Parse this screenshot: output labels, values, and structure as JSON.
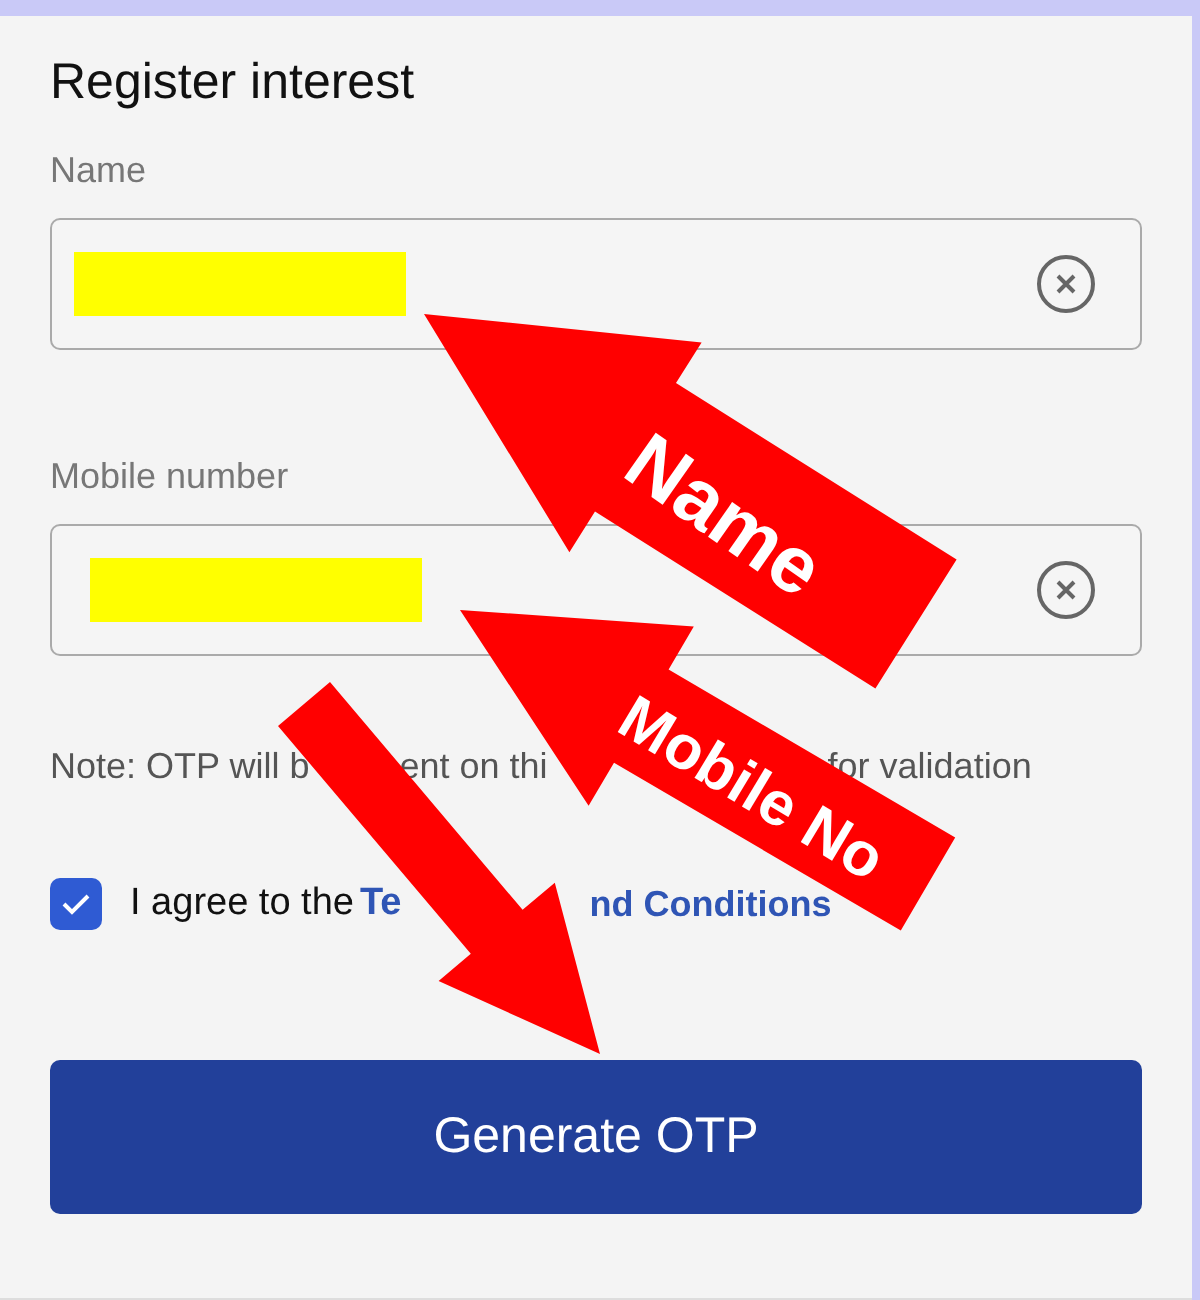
{
  "title": "Register interest",
  "fields": [
    {
      "label": "Name",
      "redacted": true
    },
    {
      "label": "Mobile number",
      "redacted": true
    }
  ],
  "note_fragments": [
    "Note: OTP will b",
    "ent on thi",
    "for validation"
  ],
  "agreement": {
    "checked": true,
    "text": "I agree to the",
    "link_fragments": [
      "Te",
      "nd Conditions"
    ]
  },
  "button": "Generate OTP",
  "annotations": [
    {
      "kind": "labelled",
      "label": "Name"
    },
    {
      "kind": "labelled",
      "label": "Mobile No"
    },
    {
      "kind": "plain"
    }
  ]
}
